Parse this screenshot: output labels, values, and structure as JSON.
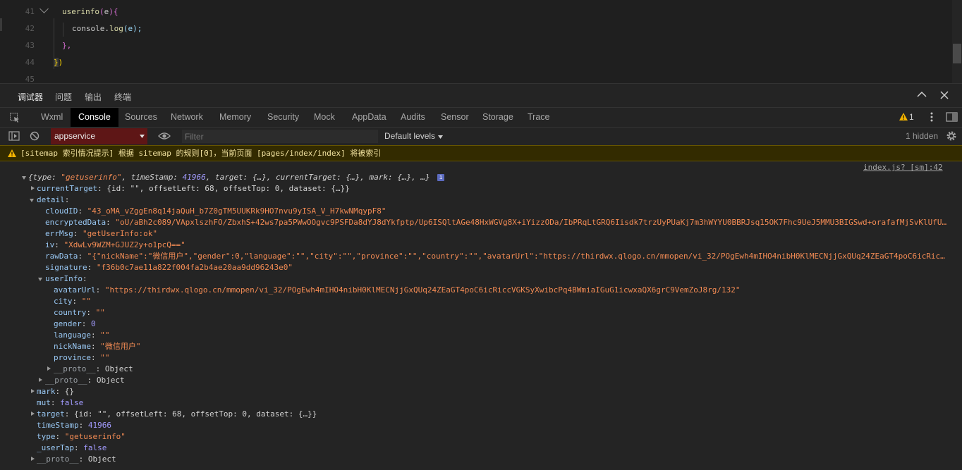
{
  "editor": {
    "lines": [
      {
        "num": "41",
        "text": "userinfo(e){"
      },
      {
        "num": "42",
        "text": "console.log(e);"
      },
      {
        "num": "43",
        "text": "},"
      },
      {
        "num": "44",
        "text": "})"
      },
      {
        "num": "45",
        "text": ""
      }
    ],
    "line41": {
      "fn": "userinfo",
      "open": "(",
      "arg": "e",
      "close": "){"
    },
    "line42": {
      "obj": "console",
      "dot": ".",
      "fn": "log",
      "args": "(e);"
    },
    "line43": "},",
    "line44": {
      "brace": "}",
      "paren": ")"
    }
  },
  "panel_tabs": [
    "调试器",
    "问题",
    "输出",
    "终端"
  ],
  "devtools_tabs": [
    "Wxml",
    "Console",
    "Sources",
    "Network",
    "Memory",
    "Security",
    "Mock",
    "AppData",
    "Audits",
    "Sensor",
    "Storage",
    "Trace"
  ],
  "warning_count": "1",
  "filter": {
    "context": "appservice",
    "placeholder": "Filter",
    "levels": "Default levels",
    "hidden": "1 hidden"
  },
  "warning_message": "[sitemap 索引情况提示] 根据 sitemap 的规则[0]，当前页面 [pages/index/index] 将被索引",
  "source_link": "index.js? [sm]:42",
  "log": {
    "summary": {
      "open": "{",
      "type_key": "type",
      "type_val": "\"getuserinfo\"",
      "ts_key": "timeStamp",
      "ts_val": "41966",
      "rest": ", target: {…}, currentTarget: {…}, mark: {…}, …}",
      "info_badge": "i"
    },
    "currentTarget": {
      "key": "currentTarget",
      "val": "{id: \"\", offsetLeft: 68, offsetTop: 0, dataset: {…}}"
    },
    "detail_key": "detail",
    "cloudID": {
      "key": "cloudID",
      "val": "\"43_oMA_vZggEn8q14jaQuH_b7Z0gTM5UUKRk9HO7nvu9yISA_V_H7kwNMqypF8\""
    },
    "encryptedData": {
      "key": "encryptedData",
      "val": "\"oU/aBh2c089/VApxlszhFO/ZbxhS+42ws7pa5PWwOOgvc9PSFDa8dYJ8dYkfptp/Up6ISQltAGe48HxWGVg8X+iYizzODa/IbPRqLtGRQ6Iisdk7trzUyPUaKj7m3hWYYU0BBRJsq15OK7Fhc9UeJ5MMU3BIGSwd+orafafMjSvKlUfU…"
    },
    "errMsg": {
      "key": "errMsg",
      "val": "\"getUserInfo:ok\""
    },
    "iv": {
      "key": "iv",
      "val": "\"XdwLv9WZM+GJUZ2y+o1pcQ==\""
    },
    "rawData": {
      "key": "rawData",
      "val": "\"{\"nickName\":\"微信用户\",\"gender\":0,\"language\":\"\",\"city\":\"\",\"province\":\"\",\"country\":\"\",\"avatarUrl\":\"https://thirdwx.qlogo.cn/mmopen/vi_32/POgEwh4mIHO4nibH0KlMECNjjGxQUq24ZEaGT4poC6icRic…"
    },
    "signature": {
      "key": "signature",
      "val": "\"f36b0c7ae11a822f004fa2b4ae20aa9dd96243e0\""
    },
    "userInfo_key": "userInfo",
    "avatarUrl": {
      "key": "avatarUrl",
      "val": "\"https://thirdwx.qlogo.cn/mmopen/vi_32/POgEwh4mIHO4nibH0KlMECNjjGxQUq24ZEaGT4poC6icRiccVGKSyXwibcPq4BWmiaIGuG1icwxaQX6grC9VemZoJ8rg/132\""
    },
    "city": {
      "key": "city",
      "val": "\"\""
    },
    "country": {
      "key": "country",
      "val": "\"\""
    },
    "gender": {
      "key": "gender",
      "val": "0"
    },
    "language": {
      "key": "language",
      "val": "\"\""
    },
    "nickName": {
      "key": "nickName",
      "val": "\"微信用户\""
    },
    "province": {
      "key": "province",
      "val": "\"\""
    },
    "proto_inner": {
      "key": "__proto__",
      "val": "Object"
    },
    "proto_detail": {
      "key": "__proto__",
      "val": "Object"
    },
    "mark": {
      "key": "mark",
      "val": "{}"
    },
    "mut": {
      "key": "mut",
      "val": "false"
    },
    "target": {
      "key": "target",
      "val": "{id: \"\", offsetLeft: 68, offsetTop: 0, dataset: {…}}"
    },
    "timeStamp": {
      "key": "timeStamp",
      "val": "41966"
    },
    "type": {
      "key": "type",
      "val": "\"getuserinfo\""
    },
    "userTap": {
      "key": "_userTap",
      "val": "false"
    },
    "proto_root": {
      "key": "__proto__",
      "val": "Object"
    }
  },
  "colors": {
    "context_bg": "#5e1616",
    "warning_bg": "#332b00",
    "active_tab_bg": "#000000"
  }
}
